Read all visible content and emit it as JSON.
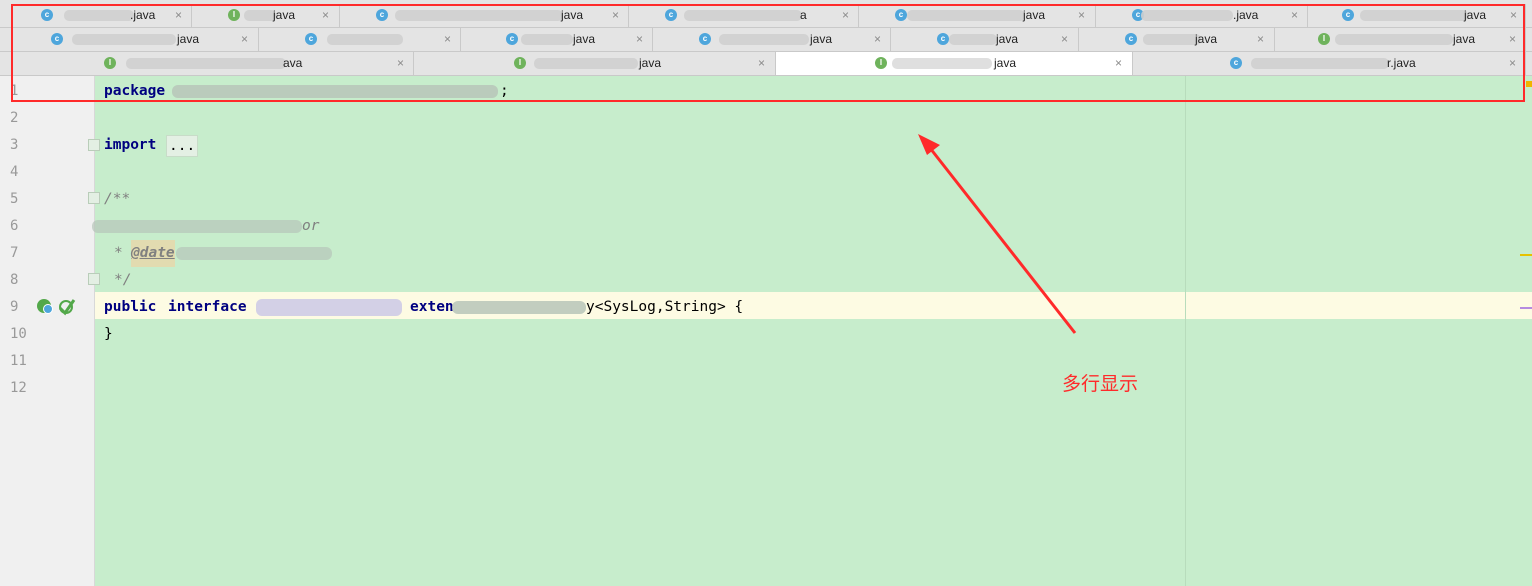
{
  "tabs": {
    "row1": [
      {
        "name": ".java",
        "kind": "c"
      },
      {
        "name": "java",
        "kind": "i"
      },
      {
        "name": "java",
        "kind": "c"
      },
      {
        "name": "a",
        "kind": "c"
      },
      {
        "name": "java",
        "kind": "c"
      },
      {
        "name": ".java",
        "kind": "c"
      },
      {
        "name": "java",
        "kind": "c"
      }
    ],
    "row2": [
      {
        "name": "java",
        "kind": "c"
      },
      {
        "name": "",
        "kind": "c"
      },
      {
        "name": "java",
        "kind": "c"
      },
      {
        "name": "java",
        "kind": "c"
      },
      {
        "name": "java",
        "kind": "c"
      },
      {
        "name": "java",
        "kind": "c"
      },
      {
        "name": "java",
        "kind": "i"
      }
    ],
    "row3": [
      {
        "name": "ava",
        "kind": "i"
      },
      {
        "name": "java",
        "kind": "i"
      },
      {
        "name": "java",
        "kind": "i"
      },
      {
        "name": "r.java",
        "kind": "c"
      }
    ],
    "close_glyph": "×",
    "active_tab": "row3-2"
  },
  "editor": {
    "line_numbers": [
      "1",
      "2",
      "3",
      "4",
      "5",
      "6",
      "7",
      "8",
      "9",
      "10",
      "11",
      "12"
    ],
    "code": {
      "package_kw": "package",
      "package_end": ";",
      "import_kw": "import",
      "import_fold": "...",
      "doc_open": "/**",
      "doc_author_frag": "or",
      "doc_date_prefix": "* ",
      "doc_date_tag": "@date",
      "doc_date_suffix": " ",
      "doc_close": "*/",
      "public_kw": "public",
      "interface_kw": "interface",
      "extends_frag": "exten",
      "generic_tail": "y<SysLog,String> {",
      "close_brace": "}"
    }
  },
  "annotation": {
    "label": "多行显示",
    "color": "#ff2a2a"
  },
  "colors": {
    "editor_bg": "#c7edcc",
    "caret_line": "#fdfbe3",
    "keyword": "#000080",
    "comment": "#808080"
  }
}
